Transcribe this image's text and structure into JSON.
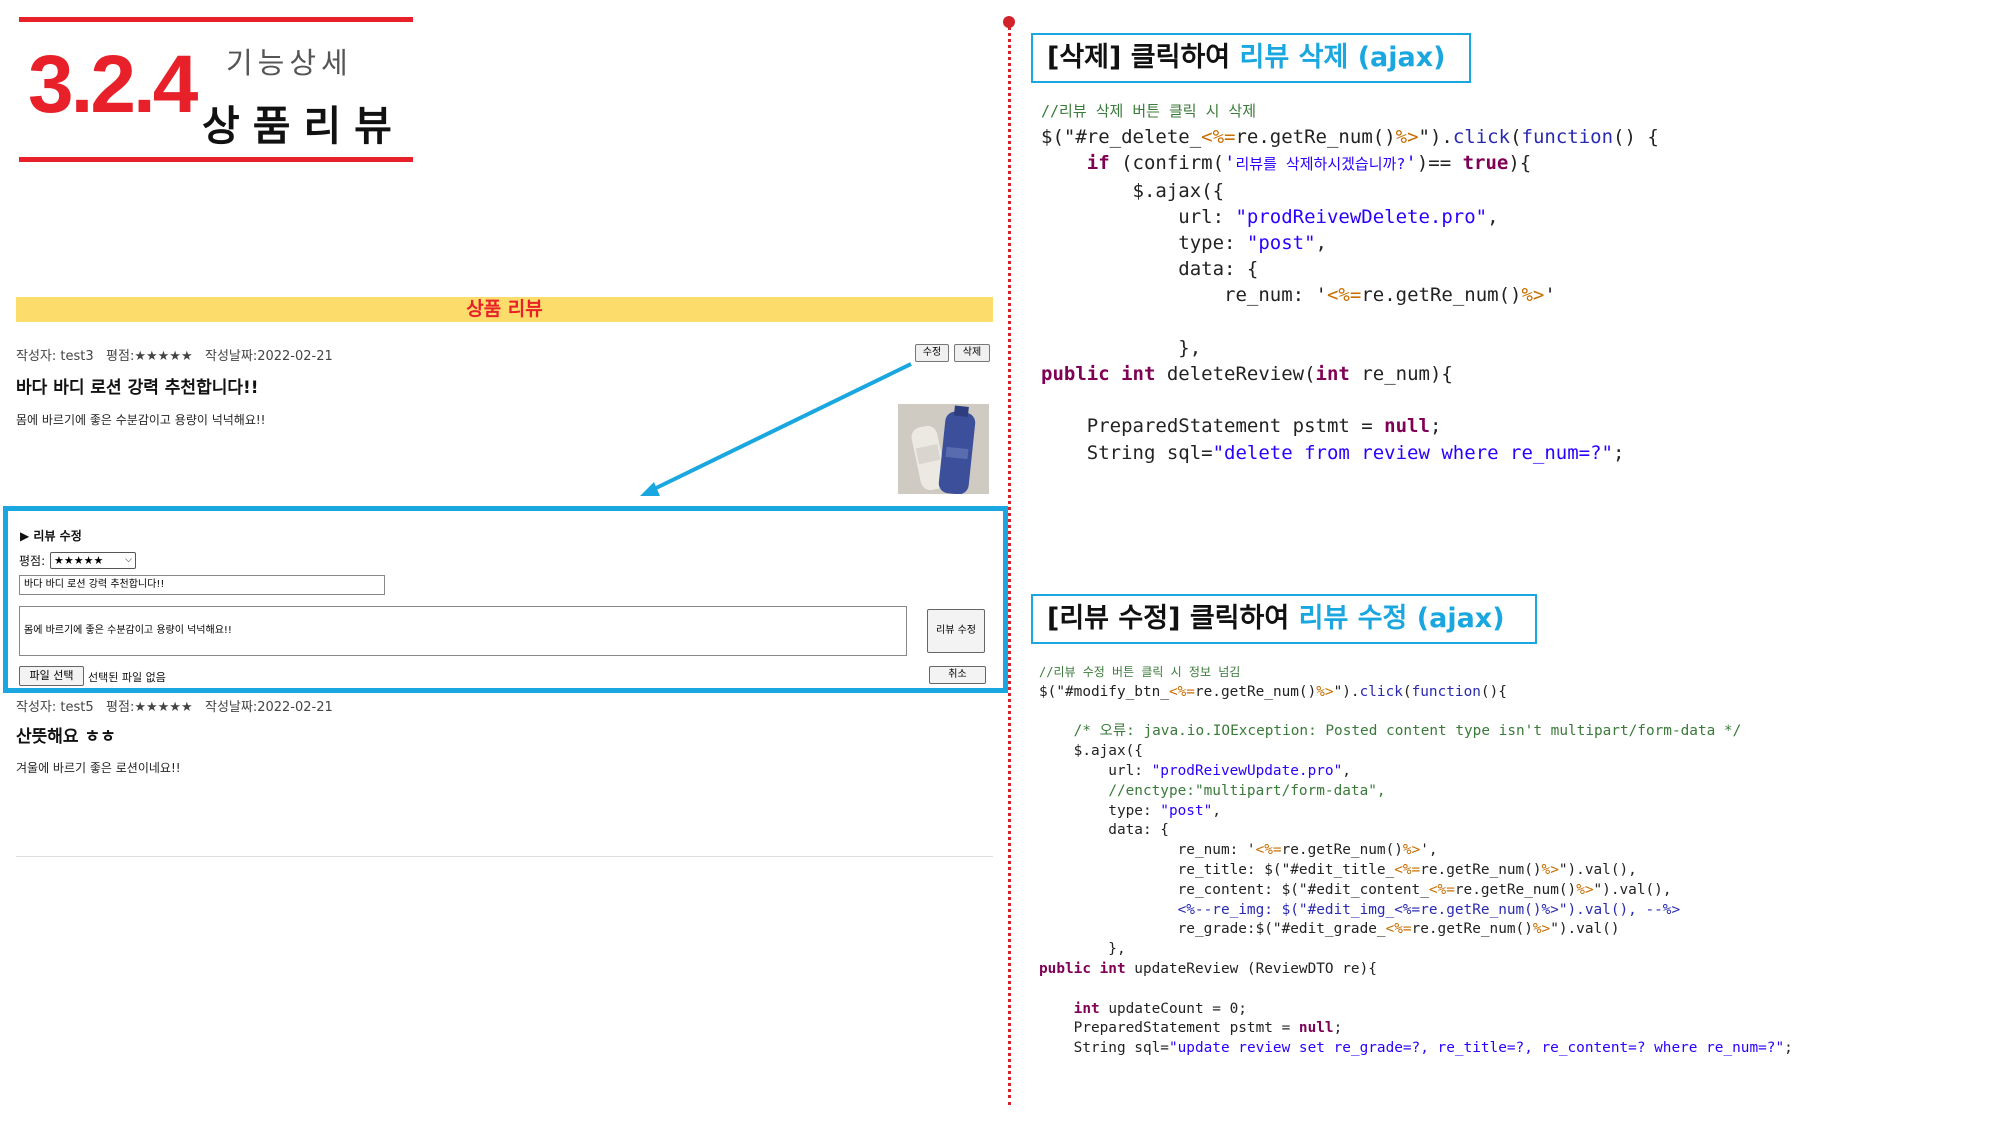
{
  "header": {
    "number": "3.2.4",
    "subtitle": "기능상세",
    "title": "상품리뷰"
  },
  "review_section": {
    "heading": "상품 리뷰",
    "reviews": [
      {
        "meta": "작성자: test3   평점:★★★★★   작성날짜:2022-02-21",
        "title": "바다 바디 로션 강력 추천합니다!!",
        "body": "몸에 바르기에 좋은 수분감이고 용량이 넉넉해요!!",
        "edit_label": "수정",
        "delete_label": "삭제"
      },
      {
        "meta": "작성자: test5   평점:★★★★★   작성날짜:2022-02-21",
        "title": "산뜻해요 ㅎㅎ",
        "body": "겨울에 바르기 좋은 로션이네요!!"
      }
    ],
    "edit_form": {
      "heading": "▶ 리뷰 수정",
      "grade_label": "평점:",
      "grade_value": "★★★★★",
      "title_value": "바다 바디 로션 강력 추천합니다!!",
      "content_value": "몸에 바르기에 좋은 수분감이고 용량이 넉넉해요!!",
      "submit_label": "리뷰 수정",
      "file_button": "파일 선택",
      "file_status": "선택된 파일 없음",
      "cancel_label": "취소"
    }
  },
  "delete_caption": {
    "prefix": "[삭제] 클릭하여 ",
    "highlight": "리뷰 삭제 (ajax)"
  },
  "update_caption": {
    "prefix": "[리뷰 수정] 클릭하여 ",
    "highlight": "리뷰 수정 (ajax)"
  },
  "colors": {
    "accent_red": "#e8202a",
    "accent_blue": "#1aa7e0",
    "banner_yellow": "#fcdc6b"
  }
}
